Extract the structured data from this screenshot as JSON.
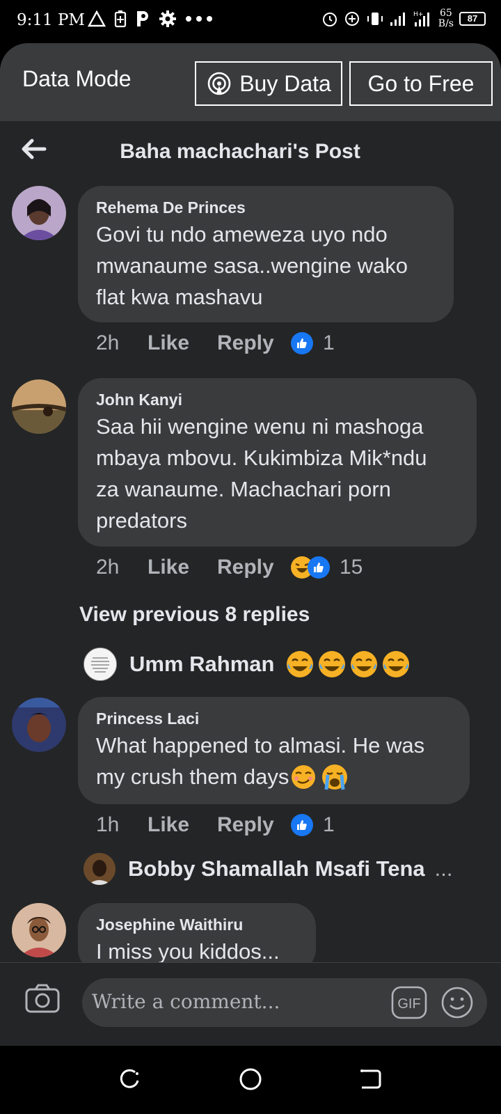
{
  "status_bar": {
    "time": "9:11 PM",
    "speed_value": "65",
    "speed_unit": "B/s",
    "battery": "87"
  },
  "data_mode": {
    "label": "Data Mode",
    "buy_data": "Buy Data",
    "go_free": "Go to Free"
  },
  "header": {
    "title": "Baha machachari's Post"
  },
  "comments": [
    {
      "name": "Rehema De Princes",
      "lines": [
        "Govi tu ndo ameweza uyo ndo",
        "mwanaume sasa..wengine wako",
        "flat kwa mashavu"
      ],
      "time": "2h",
      "like": "Like",
      "reply": "Reply",
      "reaction_count": "1"
    },
    {
      "name": "John Kanyi",
      "lines": [
        "Saa hii wengine wenu ni mashoga",
        "mbaya mbovu. Kukimbiza Mik*ndu",
        "za wanaume. Machachari porn",
        "predators"
      ],
      "time": "2h",
      "like": "Like",
      "reply": "Reply",
      "reaction_count": "15"
    },
    {
      "name": "Princess Laci",
      "lines": [
        "What happened to almasi. He was",
        "my crush them days"
      ],
      "time": "1h",
      "like": "Like",
      "reply": "Reply",
      "reaction_count": "1"
    },
    {
      "name": "Josephine Waithiru",
      "lines": [
        "I miss you kiddos..."
      ]
    }
  ],
  "view_previous": "View previous 8 replies",
  "reply_previews": [
    {
      "name": "Umm Rahman"
    },
    {
      "name": "Bobby Shamallah Msafi Tena",
      "ellipsis": "..."
    }
  ],
  "composer": {
    "placeholder": "Write a comment...",
    "gif": "GIF"
  },
  "colors": {
    "bg": "#242526",
    "bubble": "#3a3b3c",
    "like_blue": "#1877f2",
    "emoji_yellow": "#f7b125"
  }
}
